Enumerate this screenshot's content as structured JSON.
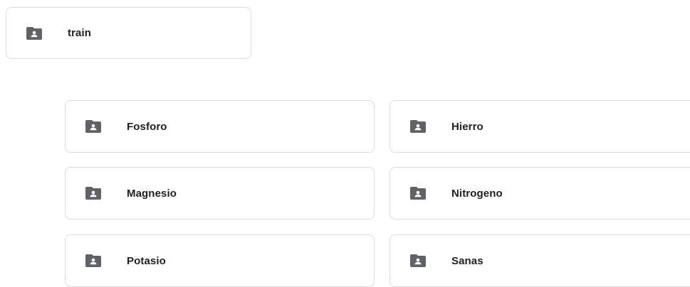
{
  "parent_folder": {
    "name": "train",
    "icon": "shared-folder-icon"
  },
  "subfolders": [
    {
      "name": "Fosforo",
      "icon": "shared-folder-icon"
    },
    {
      "name": "Hierro",
      "icon": "shared-folder-icon"
    },
    {
      "name": "Magnesio",
      "icon": "shared-folder-icon"
    },
    {
      "name": "Nitrogeno",
      "icon": "shared-folder-icon"
    },
    {
      "name": "Potasio",
      "icon": "shared-folder-icon"
    },
    {
      "name": "Sanas",
      "icon": "shared-folder-icon"
    }
  ],
  "colors": {
    "icon": "#5f6368",
    "text": "#202124",
    "border": "#dadce0"
  }
}
